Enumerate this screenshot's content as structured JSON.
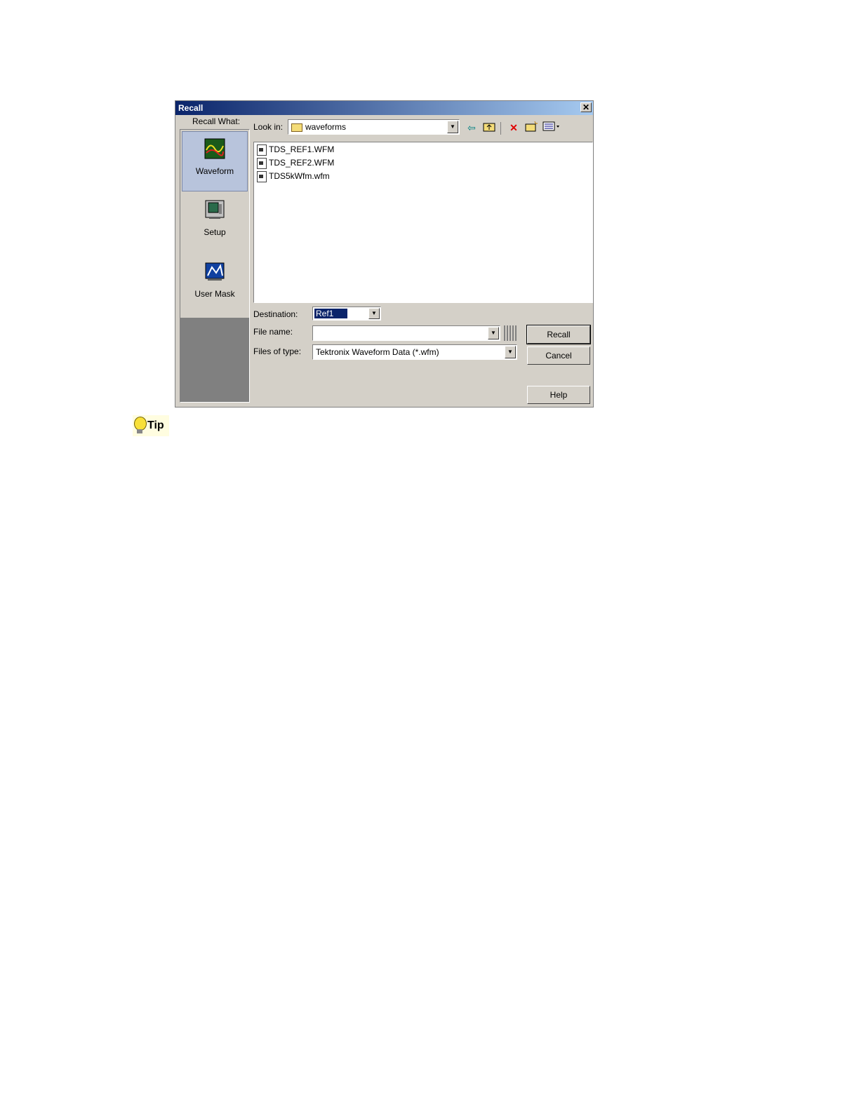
{
  "dialog": {
    "title": "Recall",
    "close_icon": "close-icon",
    "recall_what_label": "Recall What:",
    "categories": [
      {
        "label": "Waveform",
        "icon": "waveform-icon",
        "selected": true
      },
      {
        "label": "Setup",
        "icon": "setup-icon",
        "selected": false
      },
      {
        "label": "User Mask",
        "icon": "user-mask-icon",
        "selected": false
      }
    ],
    "look_in_label": "Look in:",
    "look_in_value": "waveforms",
    "toolbar": [
      "back-icon",
      "up-folder-icon",
      "delete-icon",
      "new-folder-icon",
      "view-menu-icon"
    ],
    "files": [
      "TDS_REF1.WFM",
      "TDS_REF2.WFM",
      "TDS5kWfm.wfm"
    ],
    "destination_label": "Destination:",
    "destination_value": "Ref1",
    "file_name_label": "File name:",
    "file_name_value": "",
    "files_of_type_label": "Files of type:",
    "files_of_type_value": "Tektronix Waveform Data (*.wfm)",
    "recall_button": "Recall",
    "cancel_button": "Cancel",
    "help_button": "Help"
  },
  "tip": {
    "label": "Tip",
    "icon": "lightbulb-icon"
  },
  "colors": {
    "titlebar": "#0a246a",
    "face": "#d4d0c8",
    "selected": "#b8c4dc"
  }
}
